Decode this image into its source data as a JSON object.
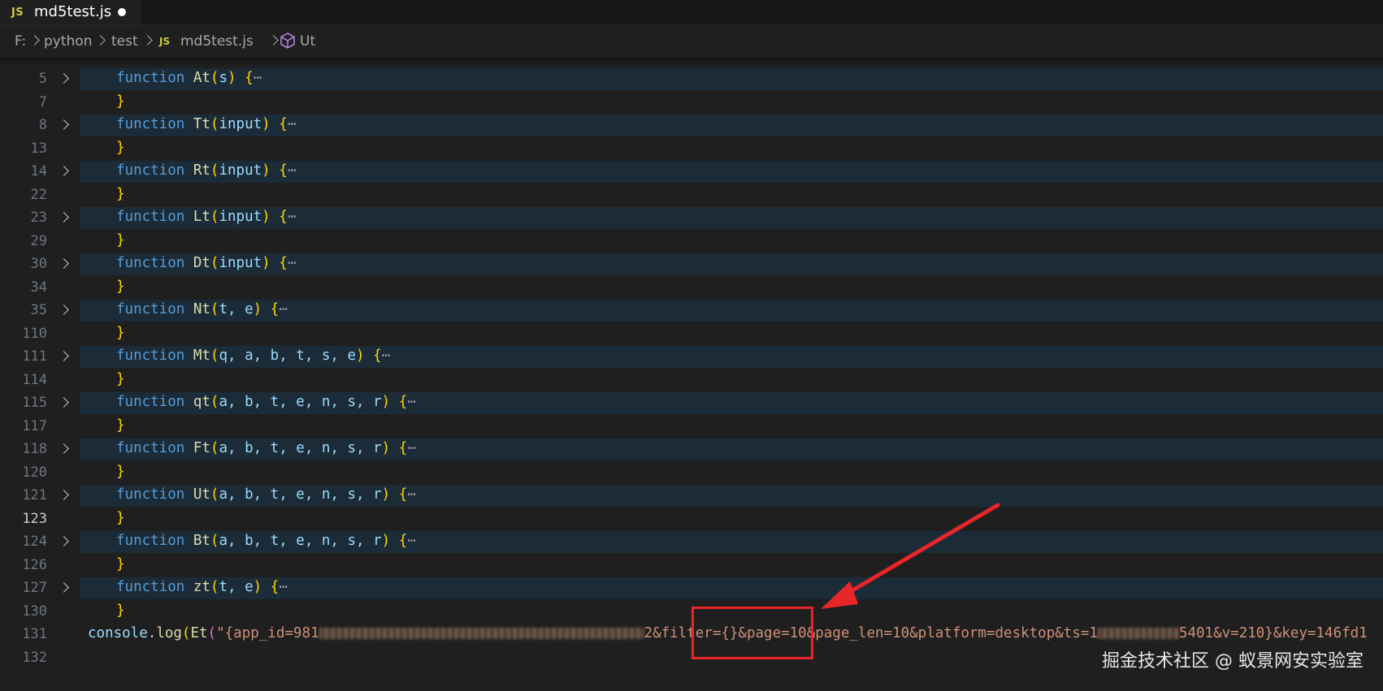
{
  "tab": {
    "icon": "JS",
    "label": "md5test.js",
    "modified_icon": "dirty-dot-icon"
  },
  "breadcrumb": {
    "drive": "F:",
    "folder1": "python",
    "folder2": "test",
    "file_icon": "JS",
    "file": "md5test.js",
    "symbol_icon": "cube-icon",
    "symbol": "Ut"
  },
  "editor": {
    "active_line": "123",
    "lines": [
      {
        "num": "5",
        "fold": true,
        "name": "At",
        "params": "s"
      },
      {
        "num": "7",
        "close": true
      },
      {
        "num": "8",
        "fold": true,
        "name": "Tt",
        "params": "input"
      },
      {
        "num": "13",
        "close": true
      },
      {
        "num": "14",
        "fold": true,
        "name": "Rt",
        "params": "input"
      },
      {
        "num": "22",
        "close": true
      },
      {
        "num": "23",
        "fold": true,
        "name": "Lt",
        "params": "input"
      },
      {
        "num": "29",
        "close": true
      },
      {
        "num": "30",
        "fold": true,
        "name": "Dt",
        "params": "input"
      },
      {
        "num": "34",
        "close": true
      },
      {
        "num": "35",
        "fold": true,
        "name": "Nt",
        "params": "t, e"
      },
      {
        "num": "110",
        "close": true
      },
      {
        "num": "111",
        "fold": true,
        "name": "Mt",
        "params": "q, a, b, t, s, e"
      },
      {
        "num": "114",
        "close": true
      },
      {
        "num": "115",
        "fold": true,
        "name": "qt",
        "params": "a, b, t, e, n, s, r"
      },
      {
        "num": "117",
        "close": true
      },
      {
        "num": "118",
        "fold": true,
        "name": "Ft",
        "params": "a, b, t, e, n, s, r"
      },
      {
        "num": "120",
        "close": true
      },
      {
        "num": "121",
        "fold": true,
        "name": "Ut",
        "params": "a, b, t, e, n, s, r"
      },
      {
        "num": "123",
        "close": true
      },
      {
        "num": "124",
        "fold": true,
        "name": "Bt",
        "params": "a, b, t, e, n, s, r"
      },
      {
        "num": "126",
        "close": true
      },
      {
        "num": "127",
        "fold": true,
        "name": "zt",
        "params": "t, e"
      },
      {
        "num": "130",
        "close": true
      },
      {
        "num": "131",
        "console": true
      },
      {
        "num": "132"
      }
    ],
    "keyword": "function",
    "ellipsis": "⋯",
    "console_line": {
      "obj": "console",
      "dot": ".",
      "method": "log",
      "callee": "Et",
      "str_part1": "\"{app_id=981",
      "str_part2": "2&filter={}&page=10&page_len=10&platform=desktop&ts=1",
      "str_part3": "5401&v=210}&key=146fd1"
    }
  },
  "watermark": "掘金技术社区 @ 蚁景网安实验室",
  "colors": {
    "keyword": "#569cd6",
    "function_name": "#dcdcaa",
    "bracket": "#ffd700",
    "string": "#ce9178",
    "annotation": "#e8262a"
  }
}
